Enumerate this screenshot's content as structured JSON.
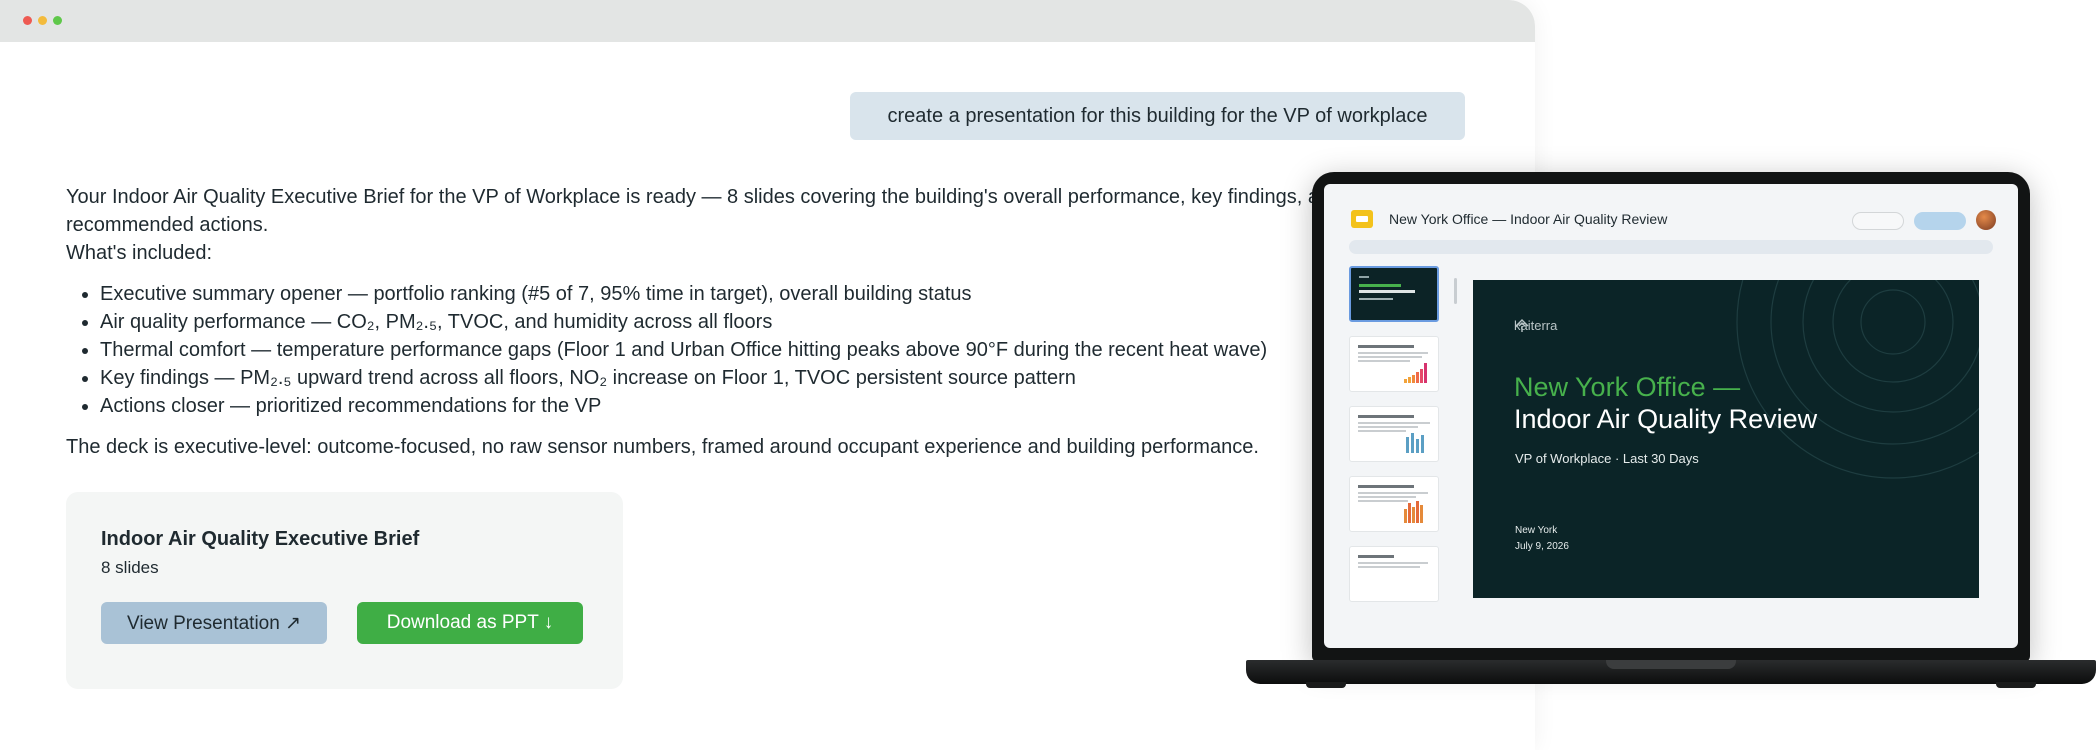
{
  "chat": {
    "user_message": "create a presentation for this building for the VP of workplace",
    "reply": {
      "line1": "Your Indoor Air Quality Executive Brief for the VP of Workplace is ready — 8 slides covering the building's overall performance, key findings, and",
      "line2": "recommended actions.",
      "included_heading": "What's included:",
      "bullets": [
        "Executive summary opener — portfolio ranking (#5 of 7, 95% time in target), overall building status",
        "Air quality performance — CO₂, PM₂.₅, TVOC, and humidity across all floors",
        "Thermal comfort — temperature performance gaps (Floor 1 and Urban Office hitting peaks above 90°F during the recent heat wave)",
        "Key findings — PM₂.₅ upward trend across all floors, NO₂ increase on Floor 1, TVOC persistent source pattern",
        "Actions closer — prioritized recommendations for the VP"
      ],
      "closing": "The deck is executive-level: outcome-focused, no raw sensor numbers, framed around occupant experience and building performance."
    }
  },
  "card": {
    "title": "Indoor Air Quality Executive Brief",
    "subtitle": "8 slides",
    "view_label": "View Presentation ↗",
    "download_label": "Download as PPT ↓",
    "view_color": "#a9c2d6",
    "download_color": "#3fae45"
  },
  "laptop": {
    "app_title": "New York Office — Indoor Air Quality Review",
    "app_icon": "slides-icon",
    "slide": {
      "brand": "kaiterra",
      "title_line1": "New York Office —",
      "title_line2": "Indoor Air Quality Review",
      "subtitle": "VP of Workplace · Last 30 Days",
      "location": "New York",
      "date": "July 9, 2026",
      "accent_color": "#47b14c",
      "background_color": "#0b2427"
    }
  }
}
